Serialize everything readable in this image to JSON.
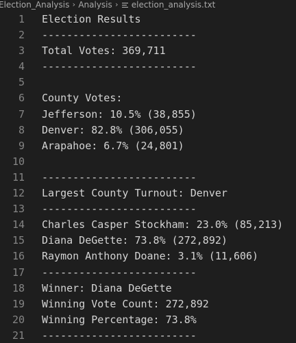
{
  "breadcrumb": {
    "folder": "Election_Analysis",
    "subfolder": "Analysis",
    "file": "election_analysis.txt",
    "file_icon": "text-file-icon"
  },
  "editor": {
    "lines": [
      {
        "number": "1",
        "text": "Election Results"
      },
      {
        "number": "2",
        "text": "-------------------------"
      },
      {
        "number": "3",
        "text": "Total Votes: 369,711"
      },
      {
        "number": "4",
        "text": "-------------------------"
      },
      {
        "number": "5",
        "text": ""
      },
      {
        "number": "6",
        "text": "County Votes:"
      },
      {
        "number": "7",
        "text": "Jefferson: 10.5% (38,855)"
      },
      {
        "number": "8",
        "text": "Denver: 82.8% (306,055)"
      },
      {
        "number": "9",
        "text": "Arapahoe: 6.7% (24,801)"
      },
      {
        "number": "10",
        "text": ""
      },
      {
        "number": "11",
        "text": "-------------------------"
      },
      {
        "number": "12",
        "text": "Largest County Turnout: Denver"
      },
      {
        "number": "13",
        "text": "-------------------------"
      },
      {
        "number": "14",
        "text": "Charles Casper Stockham: 23.0% (85,213)"
      },
      {
        "number": "15",
        "text": "Diana DeGette: 73.8% (272,892)"
      },
      {
        "number": "16",
        "text": "Raymon Anthony Doane: 3.1% (11,606)"
      },
      {
        "number": "17",
        "text": "-------------------------"
      },
      {
        "number": "18",
        "text": "Winner: Diana DeGette"
      },
      {
        "number": "19",
        "text": "Winning Vote Count: 272,892"
      },
      {
        "number": "20",
        "text": "Winning Percentage: 73.8%"
      },
      {
        "number": "21",
        "text": "-------------------------"
      }
    ]
  },
  "colors": {
    "background": "#1e1e1e",
    "text": "#d4d4d4",
    "line_number": "#858585",
    "breadcrumb": "#a9a9a9"
  }
}
